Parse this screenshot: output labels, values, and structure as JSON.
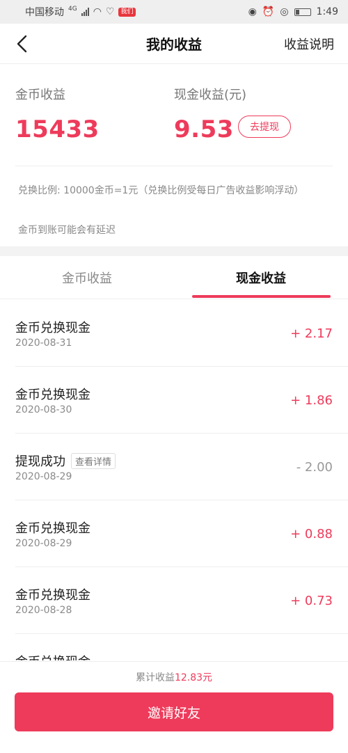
{
  "status_bar": {
    "carrier": "中国移动",
    "network": "4G",
    "app_badge": "我们",
    "time": "1:49"
  },
  "nav": {
    "title": "我的收益",
    "right_link": "收益说明"
  },
  "summary": {
    "coin_label": "金币收益",
    "coin_value": "15433",
    "cash_label": "现金收益(元)",
    "cash_value": "9.53",
    "withdraw_label": "去提现",
    "exchange_note": "兑换比例: 10000金币=1元（兑换比例受每日广告收益影响浮动）",
    "delay_note": "金币到账可能会有延迟"
  },
  "tabs": [
    {
      "label": "金币收益",
      "active": false
    },
    {
      "label": "现金收益",
      "active": true
    }
  ],
  "records": [
    {
      "title": "金币兑换现金",
      "date": "2020-08-31",
      "amount": "+ 2.17",
      "tag": ""
    },
    {
      "title": "金币兑换现金",
      "date": "2020-08-30",
      "amount": "+ 1.86",
      "tag": ""
    },
    {
      "title": "提现成功",
      "date": "2020-08-29",
      "amount": "- 2.00",
      "tag": "查看详情"
    },
    {
      "title": "金币兑换现金",
      "date": "2020-08-29",
      "amount": "+ 0.88",
      "tag": ""
    },
    {
      "title": "金币兑换现金",
      "date": "2020-08-28",
      "amount": "+ 0.73",
      "tag": ""
    },
    {
      "title": "金币兑换现金",
      "date": "",
      "amount": "",
      "tag": ""
    }
  ],
  "footer": {
    "total_prefix": "累计收益",
    "total_amount": "12.83元",
    "invite_label": "邀请好友"
  },
  "colors": {
    "accent": "#ee3b5b",
    "muted_text": "#888888"
  }
}
